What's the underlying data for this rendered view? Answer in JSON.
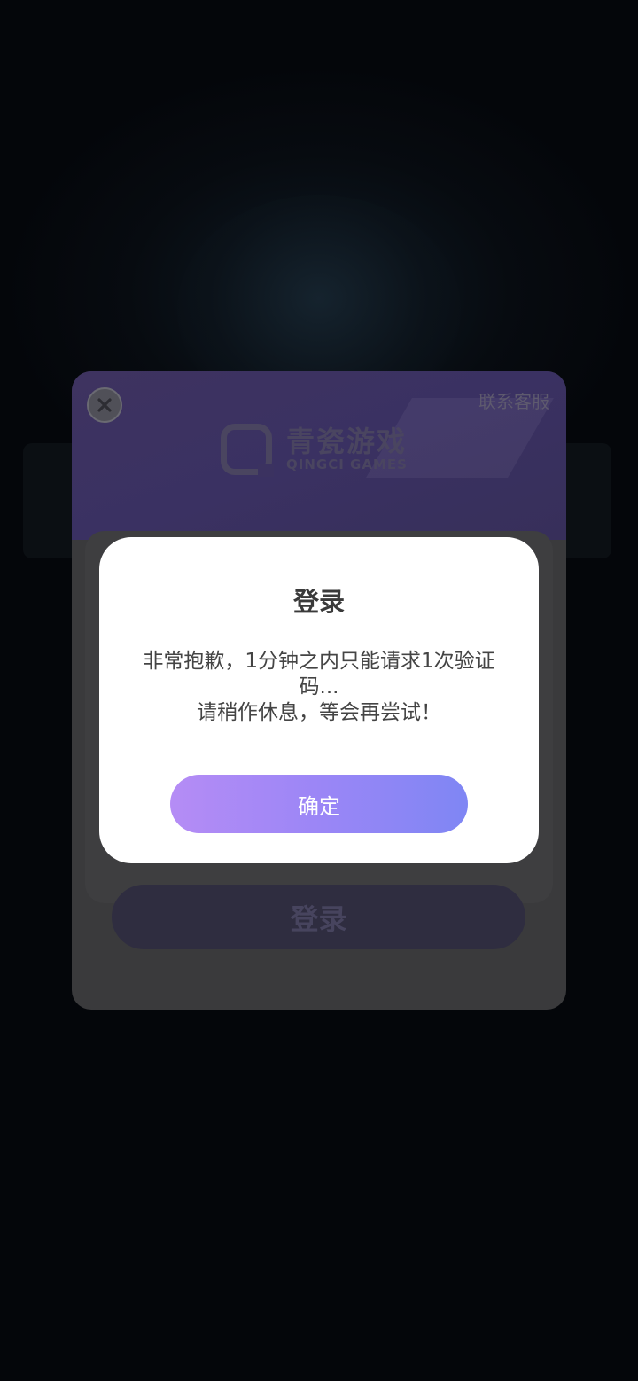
{
  "login_panel": {
    "contact_label": "联系客服",
    "brand_name_cn": "青瓷游戏",
    "brand_name_en": "QINGCI GAMES",
    "submit_label": "登录"
  },
  "dialog": {
    "title": "登录",
    "message_line1": "非常抱歉，1分钟之内只能请求1次验证码...",
    "message_line2": "请稍作休息，等会再尝试！",
    "confirm_label": "确定"
  },
  "colors": {
    "accent_gradient_start": "#b58cf5",
    "accent_gradient_end": "#7f86f4",
    "panel_bg": "#3a3a3c",
    "dialog_bg": "#ffffff"
  },
  "icons": {
    "close": "close-icon"
  }
}
